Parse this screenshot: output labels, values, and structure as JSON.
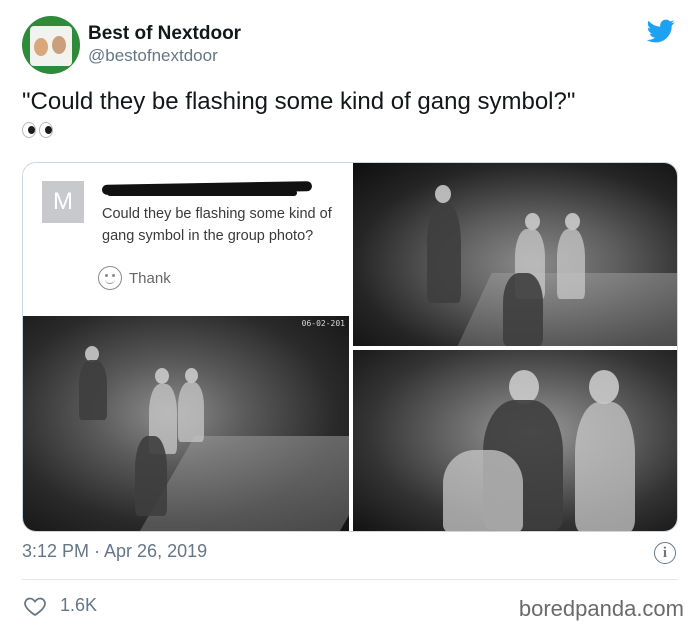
{
  "account": {
    "display_name": "Best of Nextdoor",
    "handle": "@bestofnextdoor",
    "avatar_icon": "nextdoor-house-avatar",
    "bird_icon": "twitter-bird-icon",
    "bird_color": "#1da1f2"
  },
  "tweet": {
    "text": "\"Could they be flashing some kind of gang symbol?\"",
    "emoji_icon": "eyes-emoji"
  },
  "embedded_post": {
    "avatar_letter": "M",
    "line1": "Could they be flashing some kind of",
    "line2": "gang symbol in the group photo?",
    "thank_label": "Thank",
    "thank_icon": "smiley-icon"
  },
  "photos": {
    "camera_timestamp": "06-02-201"
  },
  "meta": {
    "time": "3:12 PM · Apr 26, 2019",
    "info_icon": "info-icon",
    "like_icon": "heart-icon",
    "likes": "1.6K",
    "watermark": "boredpanda.com"
  }
}
